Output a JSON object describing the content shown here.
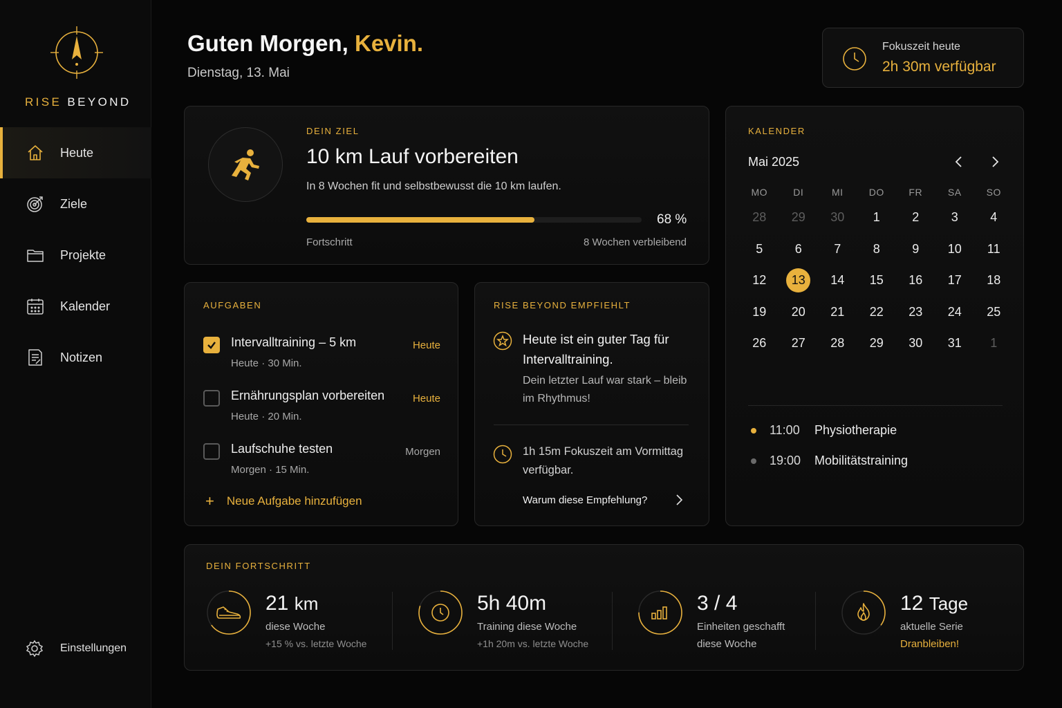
{
  "brand": {
    "word1": "RISE",
    "word2": "BEYOND"
  },
  "nav": [
    {
      "label": "Heute",
      "icon": "home-icon",
      "active": true
    },
    {
      "label": "Ziele",
      "icon": "target-icon"
    },
    {
      "label": "Projekte",
      "icon": "folder-icon"
    },
    {
      "label": "Kalender",
      "icon": "calendar-icon"
    },
    {
      "label": "Notizen",
      "icon": "notes-icon"
    }
  ],
  "settings_label": "Einstellungen",
  "header": {
    "greeting": "Guten Morgen,",
    "name": "Kevin.",
    "date": "Dienstag, 13. Mai"
  },
  "focus": {
    "label": "Fokuszeit heute",
    "value": "2h 30m verfügbar"
  },
  "goal": {
    "section": "DEIN ZIEL",
    "title": "10 km Lauf vorbereiten",
    "subtitle": "In 8 Wochen fit und selbstbewusst die 10 km laufen.",
    "progress": 0.68,
    "progress_text": "68 %",
    "progress_label": "Fortschritt",
    "remaining": "8 Wochen verbleibend"
  },
  "tasks": {
    "section": "AUFGABEN",
    "items": [
      {
        "title": "Intervalltraining – 5 km",
        "meta": "Heute · 30 Min.",
        "when": "Heute",
        "checked": true
      },
      {
        "title": "Ernährungsplan vorbereiten",
        "meta": "Heute · 20 Min.",
        "when": "Heute",
        "checked": false
      },
      {
        "title": "Laufschuhe testen",
        "meta": "Morgen · 15 Min.",
        "when": "Morgen",
        "checked": false
      }
    ],
    "add_label": "Neue Aufgabe hinzufügen"
  },
  "recommendation": {
    "section": "RISE BEYOND EMPFIEHLT",
    "title": "Heute ist ein guter Tag für Intervalltraining.",
    "body": "Dein letzter Lauf war stark – bleib im Rhythmus!",
    "focus": "1h 15m Fokuszeit am Vormittag verfügbar.",
    "why": "Warum diese Empfehlung?"
  },
  "calendar": {
    "section": "KALENDER",
    "month": "Mai 2025",
    "weekdays": [
      "MO",
      "DI",
      "MI",
      "DO",
      "FR",
      "SA",
      "SO"
    ],
    "weeks": [
      [
        {
          "d": "28",
          "m": true
        },
        {
          "d": "29",
          "m": true
        },
        {
          "d": "30",
          "m": true
        },
        {
          "d": "1"
        },
        {
          "d": "2"
        },
        {
          "d": "3"
        },
        {
          "d": "4"
        }
      ],
      [
        {
          "d": "5"
        },
        {
          "d": "6"
        },
        {
          "d": "7"
        },
        {
          "d": "8"
        },
        {
          "d": "9"
        },
        {
          "d": "10"
        },
        {
          "d": "11"
        }
      ],
      [
        {
          "d": "12"
        },
        {
          "d": "13",
          "today": true
        },
        {
          "d": "14"
        },
        {
          "d": "15"
        },
        {
          "d": "16"
        },
        {
          "d": "17"
        },
        {
          "d": "18"
        }
      ],
      [
        {
          "d": "19"
        },
        {
          "d": "20"
        },
        {
          "d": "21"
        },
        {
          "d": "22"
        },
        {
          "d": "23"
        },
        {
          "d": "24"
        },
        {
          "d": "25"
        }
      ],
      [
        {
          "d": "26"
        },
        {
          "d": "27"
        },
        {
          "d": "28"
        },
        {
          "d": "29"
        },
        {
          "d": "30"
        },
        {
          "d": "31"
        },
        {
          "d": "1",
          "m": true
        }
      ]
    ],
    "events": [
      {
        "time": "11:00",
        "title": "Physiotherapie",
        "color": "#e8b13d"
      },
      {
        "time": "19:00",
        "title": "Mobilitätstraining",
        "color": "#6a6a6a"
      }
    ]
  },
  "progress": {
    "section": "DEIN FORTSCHRITT",
    "stats": [
      {
        "value": "21",
        "unit": "km",
        "l1": "diese Woche",
        "l2": "+15 % vs. letzte Woche",
        "icon": "shoe-icon",
        "level": 0.65
      },
      {
        "value": "5h 40m",
        "unit": "",
        "l1": "Training diese Woche",
        "l2": "+1h 20m vs. letzte Woche",
        "icon": "clock-icon",
        "level": 0.8
      },
      {
        "value": "3 / 4",
        "unit": "",
        "l1": "Einheiten geschafft",
        "l2": "diese Woche",
        "icon": "bar-chart-icon",
        "level": 0.75
      },
      {
        "value": "12",
        "unit": "Tage",
        "l1": "aktuelle Serie",
        "l2": "Dranbleiben!",
        "icon": "flame-icon",
        "level": 0.35
      }
    ]
  },
  "colors": {
    "accent": "#e8b13d",
    "background": "#060606",
    "card": "#0f0f0f"
  }
}
